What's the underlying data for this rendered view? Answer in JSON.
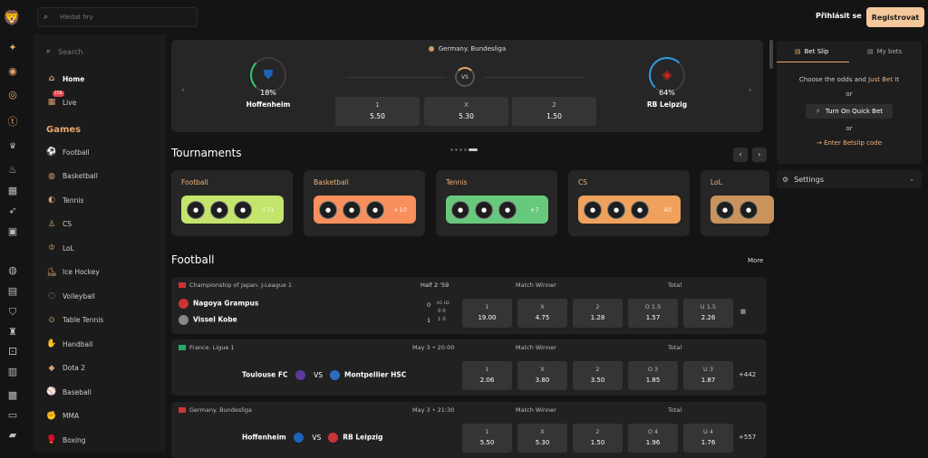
{
  "topbar": {
    "search_placeholder": "Hledat hry",
    "login_label": "Přihlásit se",
    "register_label": "Registrovat"
  },
  "rail_icons": [
    "cards-icon",
    "ball-icon",
    "roulette-icon",
    "tennis-icon",
    "trophy-icon",
    "fire-icon",
    "grid-icon",
    "rocket-icon",
    "gift-icon",
    "globe-icon",
    "cards-icon",
    "shield-icon",
    "trophy-icon",
    "dice-icon",
    "trophy-icon",
    "money-icon",
    "gamepad-icon",
    "tv-icon",
    "ticket-icon"
  ],
  "sidebar": {
    "search_placeholder": "Search",
    "home_label": "Home",
    "live_label": "Live",
    "live_badge": "158",
    "games_heading": "Games",
    "items": [
      {
        "label": "Football",
        "icon": "football-icon"
      },
      {
        "label": "Basketball",
        "icon": "basketball-icon"
      },
      {
        "label": "Tennis",
        "icon": "tennis-icon"
      },
      {
        "label": "CS",
        "icon": "cs-icon"
      },
      {
        "label": "LoL",
        "icon": "lol-icon"
      },
      {
        "label": "Ice Hockey",
        "icon": "hockey-icon"
      },
      {
        "label": "Volleyball",
        "icon": "volleyball-icon"
      },
      {
        "label": "Table Tennis",
        "icon": "table-tennis-icon"
      },
      {
        "label": "Handball",
        "icon": "handball-icon"
      },
      {
        "label": "Dota 2",
        "icon": "dota-icon"
      },
      {
        "label": "Baseball",
        "icon": "baseball-icon"
      },
      {
        "label": "MMA",
        "icon": "mma-icon"
      },
      {
        "label": "Boxing",
        "icon": "boxing-icon"
      }
    ]
  },
  "hero": {
    "league": "Germany. Bundesliga",
    "home_team": "Hoffenheim",
    "home_pct": "18%",
    "away_team": "RB Leipzig",
    "away_pct": "64%",
    "vs": "VS",
    "odds": [
      {
        "label": "1",
        "value": "5.50"
      },
      {
        "label": "X",
        "value": "5.30"
      },
      {
        "label": "2",
        "value": "1.50"
      }
    ]
  },
  "tournaments": {
    "heading": "Tournaments",
    "cards": [
      {
        "name": "Football",
        "more": "+21",
        "color": "#c4e56b"
      },
      {
        "name": "Basketball",
        "more": "+10",
        "color": "#f88f5c"
      },
      {
        "name": "Tennis",
        "more": "+7",
        "color": "#67c97c"
      },
      {
        "name": "CS",
        "more": "All",
        "color": "#f0a25c"
      },
      {
        "name": "LoL",
        "more": "",
        "color": "#c9935b"
      }
    ]
  },
  "football": {
    "heading": "Football",
    "more_label": "More",
    "matches": [
      {
        "league": "Championship of Japan. J-League 1",
        "status": "Half 2 '59",
        "market1": "Match Winner",
        "market2": "Total",
        "team1": "Nagoya Grampus",
        "team2": "Vissel Kobe",
        "score_h1": "0",
        "score_h1b": "1",
        "ht_label": "H1 H2",
        "ht1": "0 0",
        "ht2": "1 0",
        "odds": [
          {
            "label": "1",
            "value": "19.00"
          },
          {
            "label": "X",
            "value": "4.75"
          },
          {
            "label": "2",
            "value": "1.28"
          },
          {
            "label": "O 1.5",
            "value": "1.57"
          },
          {
            "label": "U 1.5",
            "value": "2.26"
          }
        ],
        "extra": ""
      },
      {
        "league": "France. Ligue 1",
        "status": "May 3 • 20:00",
        "market1": "Match Winner",
        "market2": "Total",
        "team1": "Toulouse FC",
        "team2": "Montpellier HSC",
        "vs": "VS",
        "odds": [
          {
            "label": "1",
            "value": "2.06"
          },
          {
            "label": "X",
            "value": "3.80"
          },
          {
            "label": "2",
            "value": "3.50"
          },
          {
            "label": "O 3",
            "value": "1.85"
          },
          {
            "label": "U 3",
            "value": "1.87"
          }
        ],
        "extra": "+442"
      },
      {
        "league": "Germany. Bundesliga",
        "status": "May 3 • 21:30",
        "market1": "Match Winner",
        "market2": "Total",
        "team1": "Hoffenheim",
        "team2": "RB Leipzig",
        "vs": "VS",
        "odds": [
          {
            "label": "1",
            "value": "5.50"
          },
          {
            "label": "X",
            "value": "5.30"
          },
          {
            "label": "2",
            "value": "1.50"
          },
          {
            "label": "O 4",
            "value": "1.96"
          },
          {
            "label": "U 4",
            "value": "1.76"
          }
        ],
        "extra": "+557"
      }
    ]
  },
  "betslip": {
    "tab1": "Bet Slip",
    "tab2": "My bets",
    "line1_a": "Choose the odds and ",
    "line1_b": "Just Bet It",
    "or1": "or",
    "quick_bet": "Turn On Quick Bet",
    "or2": "or",
    "enter_code": "Enter Betslip code",
    "settings_label": "Settings"
  }
}
